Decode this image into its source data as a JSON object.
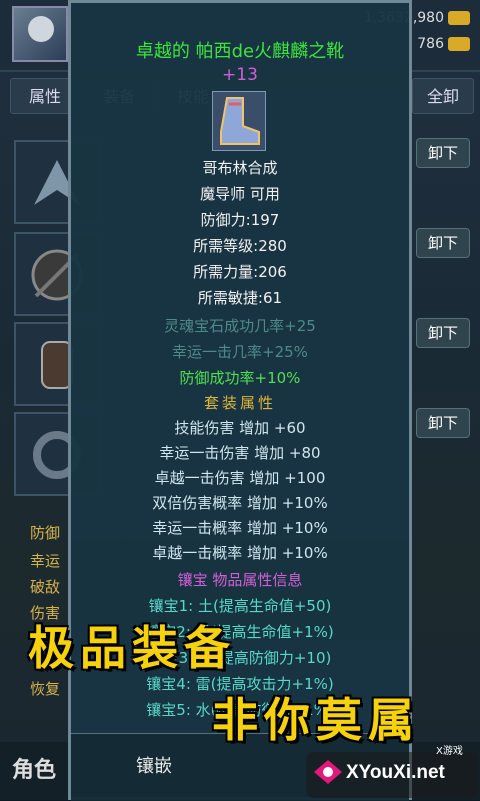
{
  "header": {
    "resource1": "1,3632,980",
    "resource2": "786"
  },
  "tabs": [
    "属性",
    "装备",
    "技能",
    "全卸"
  ],
  "slots": {
    "unequip_label": "卸下"
  },
  "attributes": [
    "防御",
    "幸运",
    "破敌",
    "伤害",
    "恢复"
  ],
  "bottom": {
    "role_label": "角色"
  },
  "item": {
    "name": "卓越的 帕西de火麒麟之靴",
    "level_plus": "+13",
    "icon": "boots-icon",
    "base_lines": [
      "哥布林合成",
      "魔导师 可用",
      "防御力:197",
      "所需等级:280",
      "所需力量:206",
      "所需敏捷:61"
    ],
    "dim_lines": [
      "灵魂宝石成功几率+25",
      "幸运一击几率+25%"
    ],
    "excellent_line": "防御成功率+10%",
    "set_header": "套装属性",
    "set_lines": [
      "技能伤害 增加 +60",
      "幸运一击伤害 增加 +80",
      "卓越一击伤害 增加 +100",
      "双倍伤害概率 增加 +10%",
      "幸运一击概率 增加 +10%",
      "卓越一击概率 增加 +10%"
    ],
    "socket_header": "镶宝  物品属性信息",
    "socket_lines": [
      "镶宝1: 土(提高生命值+50)",
      "镶宝2: 风(提高生命值+1%)",
      "镶宝3: 冰(提高防御力+10)",
      "镶宝4: 雷(提高攻击力+1%)",
      "镶宝5: 水(提高防御力+1%)"
    ],
    "embed_label": "镶嵌"
  },
  "promo": {
    "line1": "极品装备",
    "line2": "非你莫属"
  },
  "watermark": {
    "small": "X游戏",
    "site": "XYouXi.net"
  },
  "colors": {
    "title_green": "#3ee43e",
    "plus_magenta": "#d35fd8",
    "set_gold": "#e0b63a",
    "promo_yellow": "#f5d20c"
  }
}
